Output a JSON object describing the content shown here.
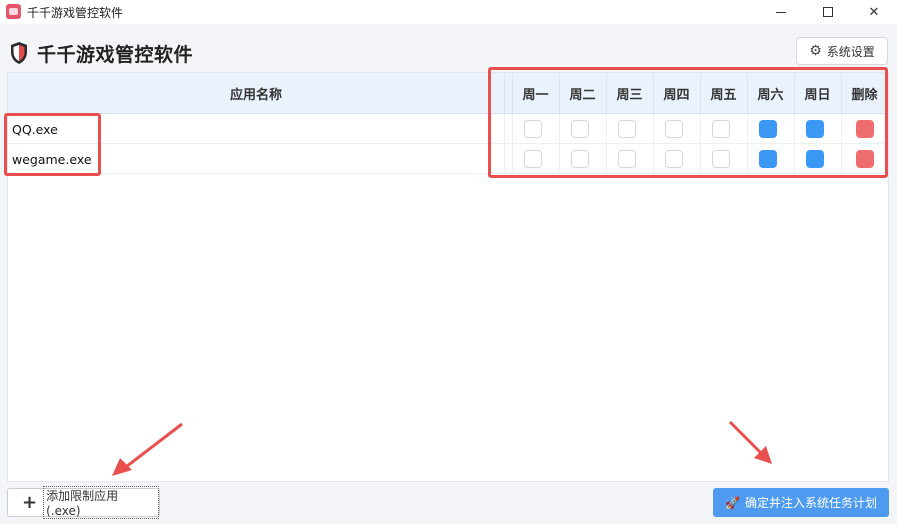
{
  "window": {
    "title": "千千游戏管控软件",
    "controls": {
      "minimize": "minimize",
      "maximize": "maximize",
      "close": "✕"
    }
  },
  "header": {
    "title": "千千游戏管控软件",
    "settings_label": "系统设置"
  },
  "table": {
    "name_header": "应用名称",
    "day_headers": [
      "周一",
      "周二",
      "周三",
      "周四",
      "周五",
      "周六",
      "周日"
    ],
    "delete_header": "删除",
    "rows": [
      {
        "name": "QQ.exe",
        "days": [
          false,
          false,
          false,
          false,
          false,
          true,
          true
        ]
      },
      {
        "name": "wegame.exe",
        "days": [
          false,
          false,
          false,
          false,
          false,
          true,
          true
        ]
      }
    ]
  },
  "footer": {
    "add_label": "添加限制应用 (.exe)",
    "confirm_label": "确定并注入系统任务计划"
  },
  "colors": {
    "accent": "#3b99f5",
    "delete": "#f06d6f",
    "highlight": "#ea4f4f",
    "header_bg": "#eaf3fd",
    "confirm_bg": "#4d9af0"
  },
  "icons": {
    "app": "app-icon",
    "shield": "shield-icon",
    "gear": "gear-icon",
    "plus": "plus-icon",
    "rocket": "rocket-icon"
  }
}
